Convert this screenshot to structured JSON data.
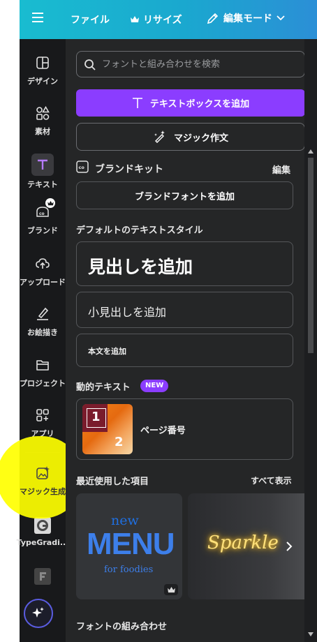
{
  "topbar": {
    "file_label": "ファイル",
    "resize_label": "リサイズ",
    "edit_mode_label": "編集モード"
  },
  "rail": {
    "items": [
      {
        "label": "デザイン",
        "icon": "layout-icon"
      },
      {
        "label": "素材",
        "icon": "shapes-icon"
      },
      {
        "label": "テキスト",
        "icon": "text-icon"
      },
      {
        "label": "ブランド",
        "icon": "brand-icon"
      },
      {
        "label": "アップロード",
        "icon": "upload-cloud-icon"
      },
      {
        "label": "お絵描き",
        "icon": "draw-icon"
      },
      {
        "label": "プロジェクト",
        "icon": "folder-icon"
      },
      {
        "label": "アプリ",
        "icon": "apps-icon"
      },
      {
        "label": "マジック生成",
        "icon": "magic-media-icon"
      },
      {
        "label": "TypeGradi...",
        "icon": "typegradient-app-icon"
      }
    ]
  },
  "search": {
    "placeholder": "フォントと組み合わせを検索"
  },
  "buttons": {
    "add_textbox": "テキストボックスを追加",
    "magic_write": "マジック作文",
    "add_brand_font": "ブランドフォントを追加"
  },
  "brand_kit": {
    "title": "ブランドキット",
    "edit": "編集"
  },
  "default_styles": {
    "title": "デフォルトのテキストスタイル",
    "heading": "見出しを追加",
    "subheading": "小見出しを追加",
    "body": "本文を追加"
  },
  "dynamic_text": {
    "title": "動的テキスト",
    "badge": "NEW",
    "page_number_label": "ページ番号",
    "thumb_digits": [
      "1",
      "2"
    ]
  },
  "recent": {
    "title": "最近使用した項目",
    "see_all": "すべて表示",
    "card1": {
      "top": "new",
      "main": "MENU",
      "bottom": "for foodies"
    },
    "card2": {
      "main": "Sparkle"
    }
  },
  "font_combos": {
    "title": "フォントの組み合わせ"
  },
  "colors": {
    "accent": "#8b3dff",
    "panel_bg": "#252627",
    "rail_bg": "#18191b",
    "highlight": "#ffff00"
  }
}
